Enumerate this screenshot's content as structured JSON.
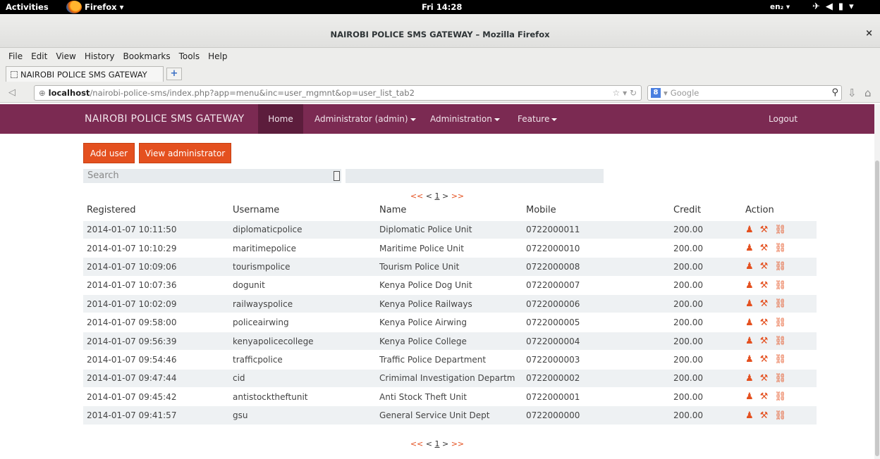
{
  "os": {
    "activities": "Activities",
    "app_menu": "Firefox",
    "clock": "Fri 14:28",
    "lang": "en₂"
  },
  "window": {
    "title": "NAIROBI POLICE SMS GATEWAY – Mozilla Firefox",
    "close": "×"
  },
  "menubar": [
    "File",
    "Edit",
    "View",
    "History",
    "Bookmarks",
    "Tools",
    "Help"
  ],
  "tab": {
    "title": "NAIROBI POLICE SMS GATEWAY",
    "new_tab": "+"
  },
  "nav": {
    "url_host": "localhost",
    "url_path": "/nairobi-police-sms/index.php?app=menu&inc=user_mgmnt&op=user_list_tab2",
    "search_engine": "Google"
  },
  "site": {
    "brand": "NAIROBI POLICE SMS GATEWAY",
    "home": "Home",
    "admin": "Administrator (admin)",
    "administration": "Administration",
    "feature": "Feature",
    "logout": "Logout"
  },
  "actions": {
    "add_user": "Add user",
    "view_admin": "View administrator",
    "search_placeholder": "Search"
  },
  "pager": {
    "first": "<<",
    "prev": "<",
    "page": "1",
    "next": ">",
    "last": ">>"
  },
  "table": {
    "headers": [
      "Registered",
      "Username",
      "Name",
      "Mobile",
      "Credit",
      "Action"
    ],
    "rows": [
      [
        "2014-01-07 10:11:50",
        "diplomaticpolice",
        "Diplomatic Police Unit",
        "0722000011",
        "200.00"
      ],
      [
        "2014-01-07 10:10:29",
        "maritimepolice",
        "Maritime Police Unit",
        "0722000010",
        "200.00"
      ],
      [
        "2014-01-07 10:09:06",
        "tourismpolice",
        "Tourism Police Unit",
        "0722000008",
        "200.00"
      ],
      [
        "2014-01-07 10:07:36",
        "dogunit",
        "Kenya Police Dog Unit",
        "0722000007",
        "200.00"
      ],
      [
        "2014-01-07 10:02:09",
        "railwayspolice",
        "Kenya Police Railways",
        "0722000006",
        "200.00"
      ],
      [
        "2014-01-07 09:58:00",
        "policeairwing",
        "Kenya Police Airwing",
        "0722000005",
        "200.00"
      ],
      [
        "2014-01-07 09:56:39",
        "kenyapolicecollege",
        "Kenya Police College",
        "0722000004",
        "200.00"
      ],
      [
        "2014-01-07 09:54:46",
        "trafficpolice",
        "Traffic Police Department",
        "0722000003",
        "200.00"
      ],
      [
        "2014-01-07 09:47:44",
        "cid",
        "Crimimal Investigation Departm",
        "0722000002",
        "200.00"
      ],
      [
        "2014-01-07 09:45:42",
        "antistocktheftunit",
        "Anti Stock Theft Unit",
        "0722000001",
        "200.00"
      ],
      [
        "2014-01-07 09:41:57",
        "gsu",
        "General Service Unit Dept",
        "0722000000",
        "200.00"
      ]
    ]
  },
  "colors": {
    "navbar": "#7b2a52",
    "accent": "#e4501f"
  }
}
